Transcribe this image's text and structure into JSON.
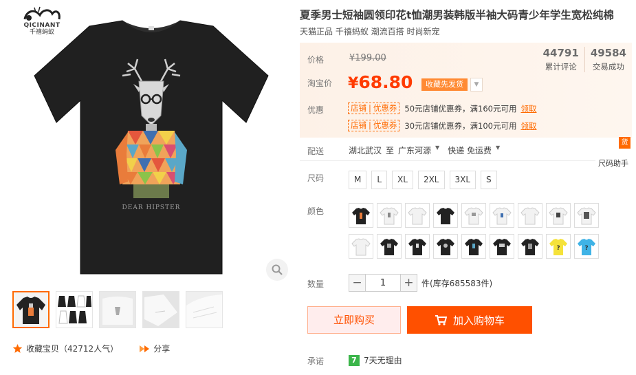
{
  "brand": {
    "name_en": "QICINANT",
    "name_cn": "千禧蚂蚁"
  },
  "gallery": {
    "print_text": "DEAR HIPSTER",
    "thumbnail_count": 5
  },
  "actions": {
    "favorite_label": "收藏宝贝（42712人气）",
    "share_label": "分享"
  },
  "product": {
    "title": "夏季男士短袖圆领印花t恤潮男装韩版半袖大码青少年学生宽松纯棉",
    "subtitle": "天猫正品 千禧蚂蚁 潮流百搭 时尚新宠"
  },
  "price": {
    "orig_label": "价格",
    "orig_value": "¥199.00",
    "sale_label": "淘宝价",
    "currency": "¥",
    "sale_value": "68.80",
    "collect_tag": "收藏先发货",
    "reviews_count": "44791",
    "reviews_label": "累计评论",
    "sales_count": "49584",
    "sales_label": "交易成功"
  },
  "promotions": {
    "label": "优惠",
    "coupons": [
      {
        "badge_a": "店铺",
        "badge_b": "优惠券",
        "text": "50元店铺优惠券，满160元可用",
        "action": "领取"
      },
      {
        "badge_a": "店铺",
        "badge_b": "优惠券",
        "text": "30元店铺优惠券，满100元可用",
        "action": "领取"
      }
    ]
  },
  "shipping": {
    "label": "配送",
    "from": "湖北武汉",
    "to_word": "至",
    "to": "广东河源",
    "method": "快递 免运费",
    "badge": "货",
    "size_help": "尺码助手"
  },
  "size": {
    "label": "尺码",
    "options": [
      "M",
      "L",
      "XL",
      "2XL",
      "3XL",
      "S"
    ]
  },
  "color": {
    "label": "颜色",
    "swatch_count": 18
  },
  "quantity": {
    "label": "数量",
    "value": "1",
    "stock_text": "件(库存685583件)"
  },
  "buttons": {
    "buy_now": "立即购买",
    "add_cart": "加入购物车"
  },
  "promise": {
    "label": "承诺",
    "icon_text": "7",
    "text": "7天无理由"
  },
  "colors": {
    "accent": "#ff5000",
    "price": "#ff3b00",
    "price_bg": "#fdf1e7"
  }
}
